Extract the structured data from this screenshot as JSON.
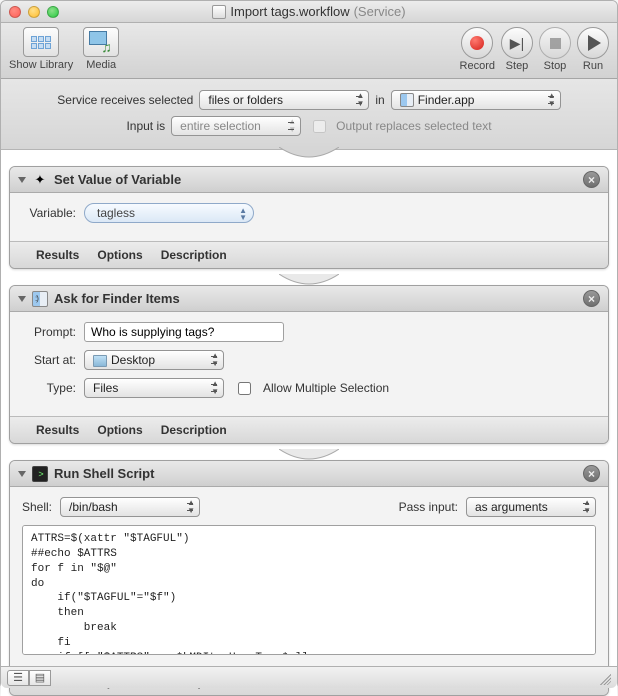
{
  "window": {
    "title": "Import tags.workflow",
    "suffix": "(Service)"
  },
  "toolbar": {
    "show_library": "Show Library",
    "media": "Media",
    "record": "Record",
    "step": "Step",
    "stop": "Stop",
    "run": "Run"
  },
  "config": {
    "receives_label": "Service receives selected",
    "receives_value": "files or folders",
    "in_label": "in",
    "app_value": "Finder.app",
    "input_is_label": "Input is",
    "input_is_value": "entire selection",
    "replaces_label": "Output replaces selected text",
    "replaces_checked": false
  },
  "actions": [
    {
      "title": "Set Value of Variable",
      "fields": {
        "variable_label": "Variable:",
        "variable_value": "tagless"
      }
    },
    {
      "title": "Ask for Finder Items",
      "fields": {
        "prompt_label": "Prompt:",
        "prompt_value": "Who is supplying tags?",
        "start_label": "Start at:",
        "start_value": "Desktop",
        "type_label": "Type:",
        "type_value": "Files",
        "allow_multi_label": "Allow Multiple Selection",
        "allow_multi_checked": false
      }
    },
    {
      "title": "Run Shell Script",
      "fields": {
        "shell_label": "Shell:",
        "shell_value": "/bin/bash",
        "pass_label": "Pass input:",
        "pass_value": "as arguments",
        "script": "ATTRS=$(xattr \"$TAGFUL\")\n##echo $ATTRS\nfor f in \"$@\"\ndo\n    if(\"$TAGFUL\"=\"$f\")\n    then\n        break\n    fi\n    if [[ \"$ATTRS\" == *kMDItemUserTags* ]]\n        then\n        TAGS=$(xattr -px com.apple.metadata:_kMDItemUserTags \"$TAGFUL\")"
      }
    }
  ],
  "foot": {
    "results": "Results",
    "options": "Options",
    "description": "Description"
  }
}
